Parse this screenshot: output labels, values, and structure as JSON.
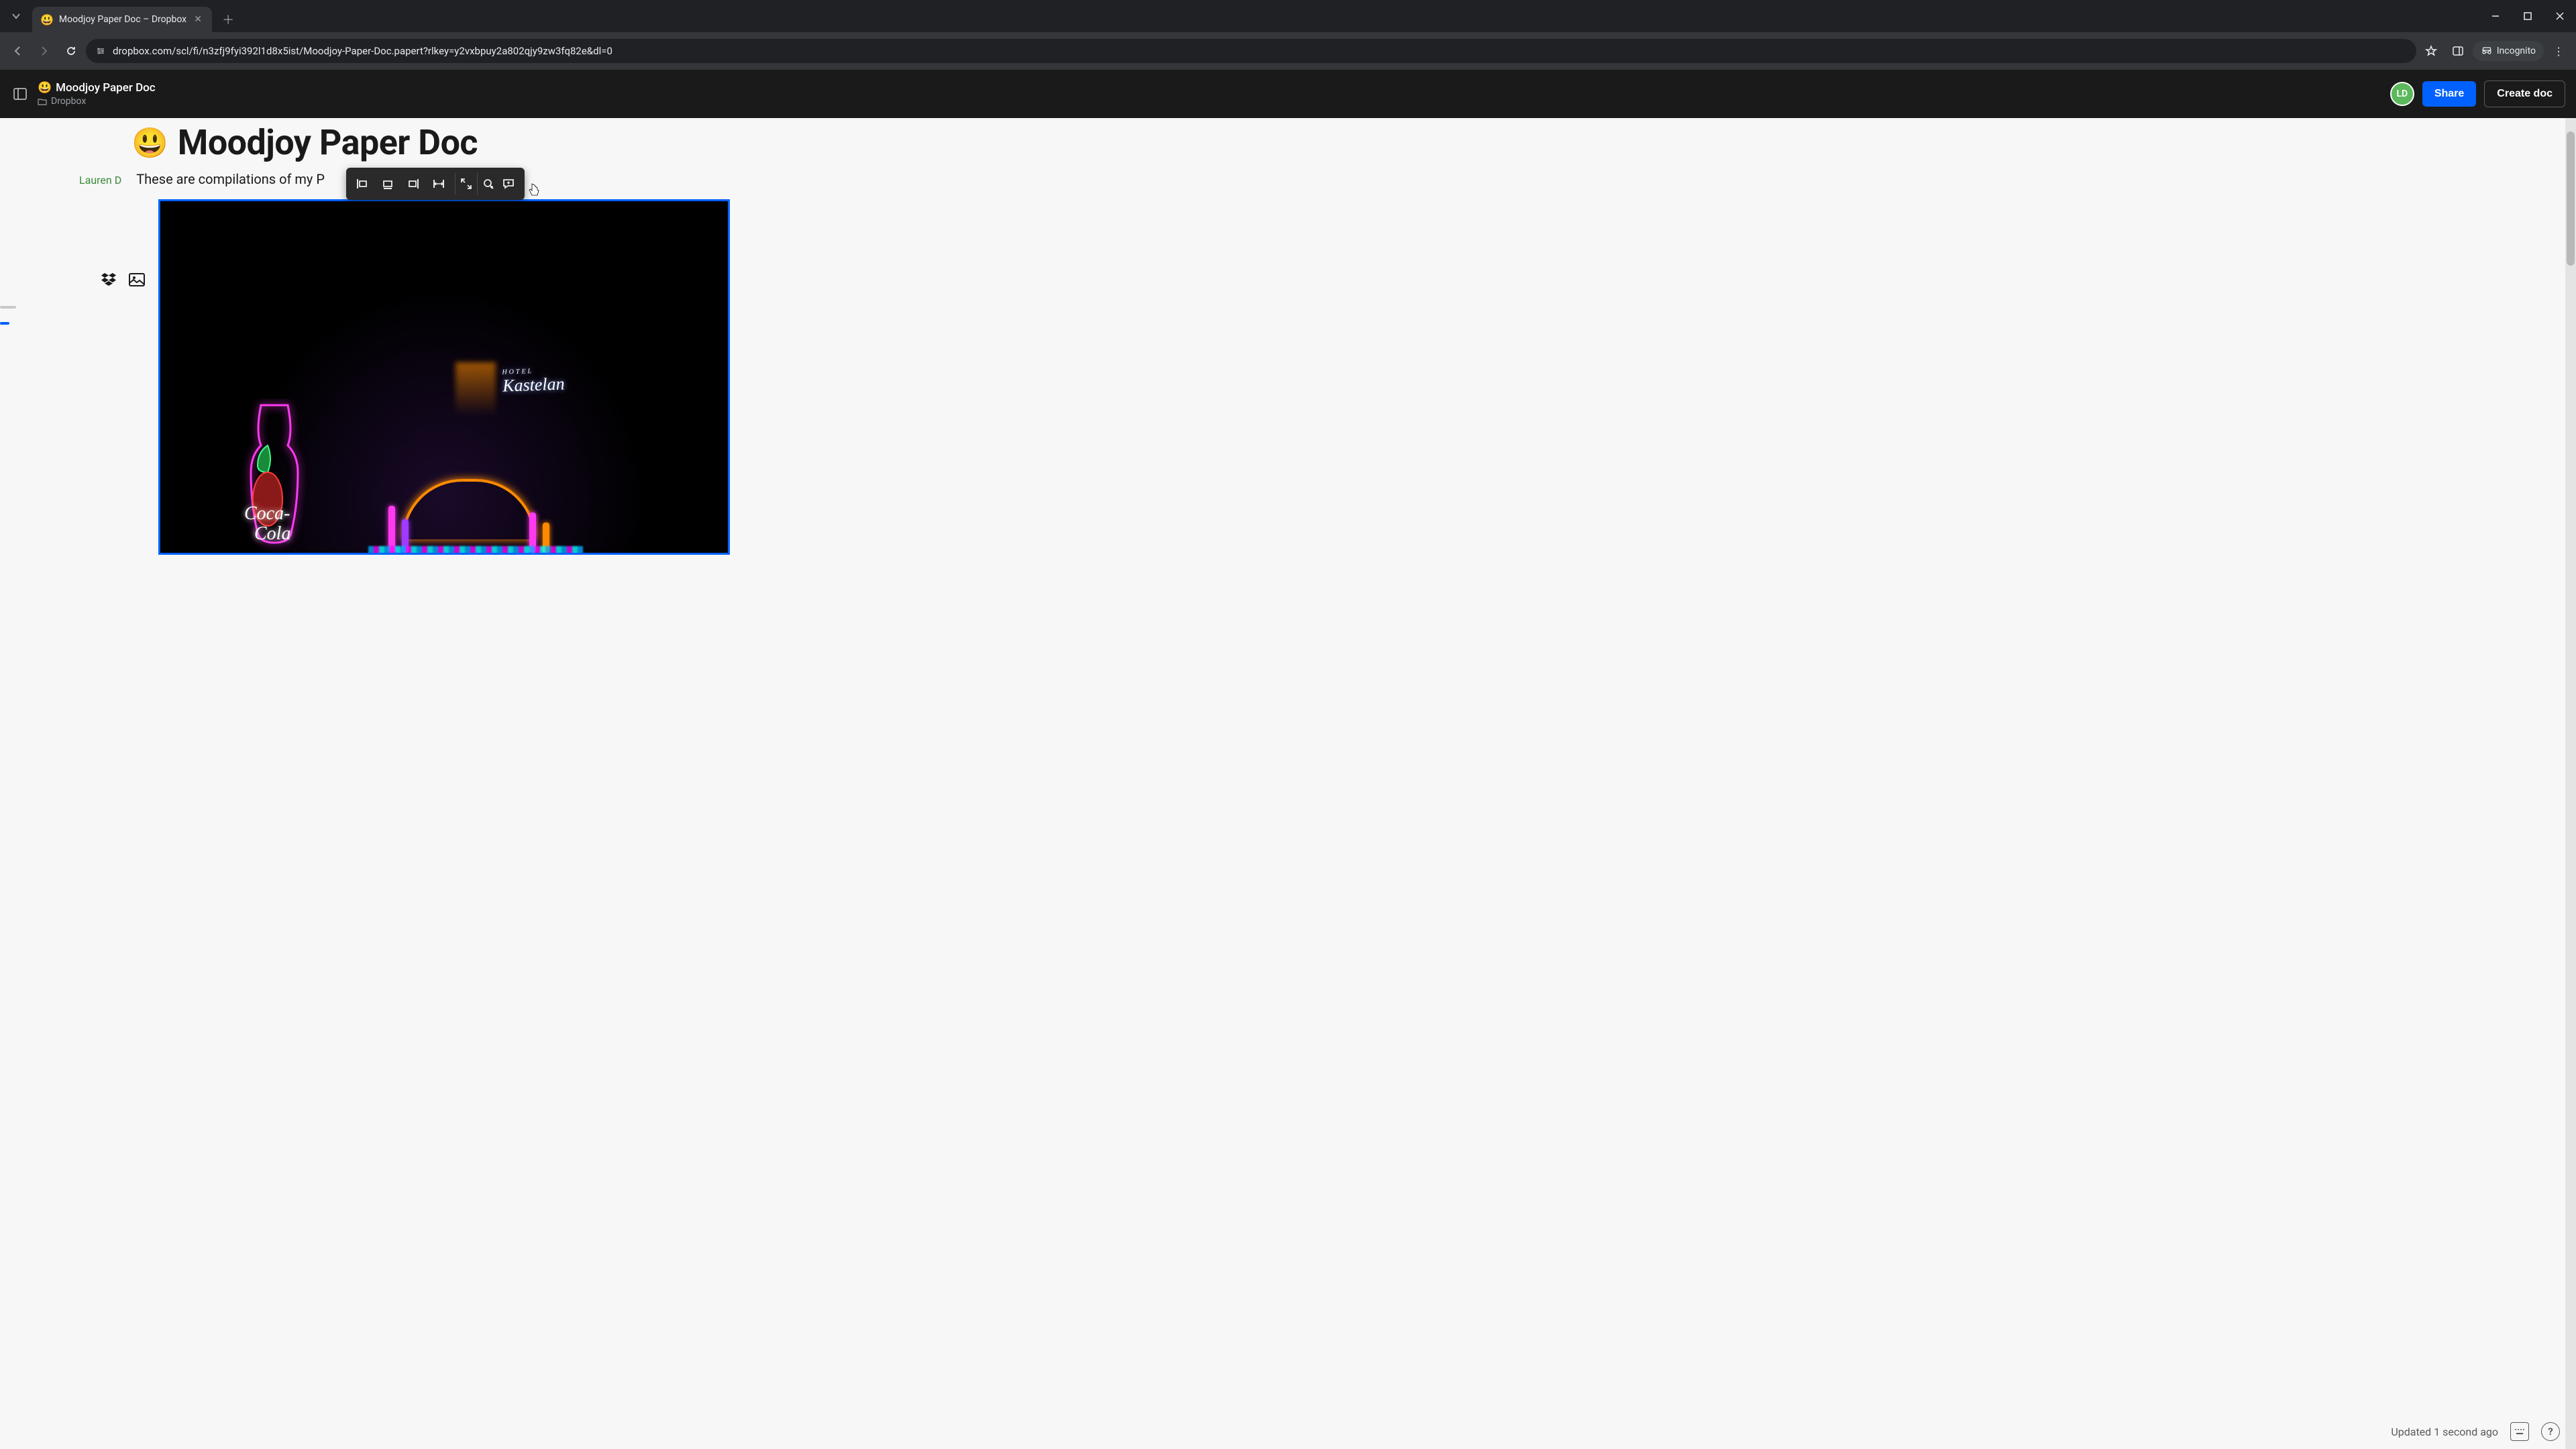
{
  "browser": {
    "tab_title": "Moodjoy Paper Doc – Dropbox",
    "url": "dropbox.com/scl/fi/n3zfj9fyi392l1d8x5ist/Moodjoy-Paper-Doc.papert?rlkey=y2vxbpuy2a802qjy9zw3fq82e&dl=0",
    "incognito_label": "Incognito"
  },
  "header": {
    "doc_emoji": "😃",
    "doc_title": "Moodjoy Paper Doc",
    "location_label": "Dropbox",
    "avatar_initials": "LD",
    "share_label": "Share",
    "create_label": "Create doc"
  },
  "document": {
    "heading_emoji": "😃",
    "heading": "Moodjoy Paper Doc",
    "author": "Lauren D",
    "subtitle_visible": "These are compilations of my P",
    "image_scene": {
      "cola_text_top": "Coca-",
      "cola_text_bottom": "Cola",
      "hotel_small": "HOTEL",
      "hotel_script": "Kastelan"
    }
  },
  "status": {
    "updated_text": "Updated 1 second ago"
  }
}
